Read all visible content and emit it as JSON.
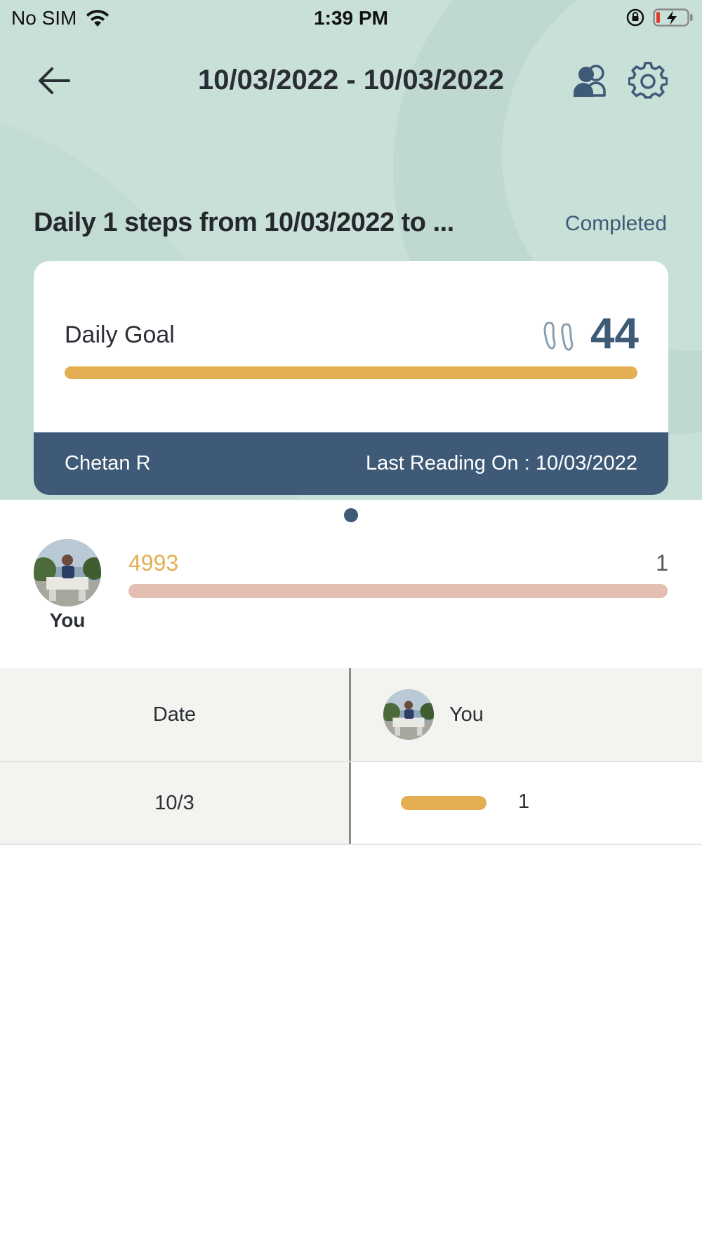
{
  "status_bar": {
    "carrier": "No SIM",
    "time": "1:39 PM"
  },
  "nav": {
    "title": "10/03/2022 - 10/03/2022"
  },
  "challenge": {
    "title": "Daily 1 steps from 10/03/2022 to ...",
    "status": "Completed"
  },
  "goal_card": {
    "label": "Daily Goal",
    "value": "44",
    "progress_percent": 100,
    "name": "Chetan R",
    "last_reading": "Last Reading On : 10/03/2022"
  },
  "participant": {
    "label": "You",
    "steps": "4993",
    "count": "1"
  },
  "table": {
    "header_date": "Date",
    "header_user": "You",
    "rows": [
      {
        "date": "10/3",
        "value": "1"
      }
    ]
  },
  "colors": {
    "accent_gold": "#e4ae53",
    "navy": "#3e5a77",
    "teal_bg": "#c8e0d8"
  }
}
